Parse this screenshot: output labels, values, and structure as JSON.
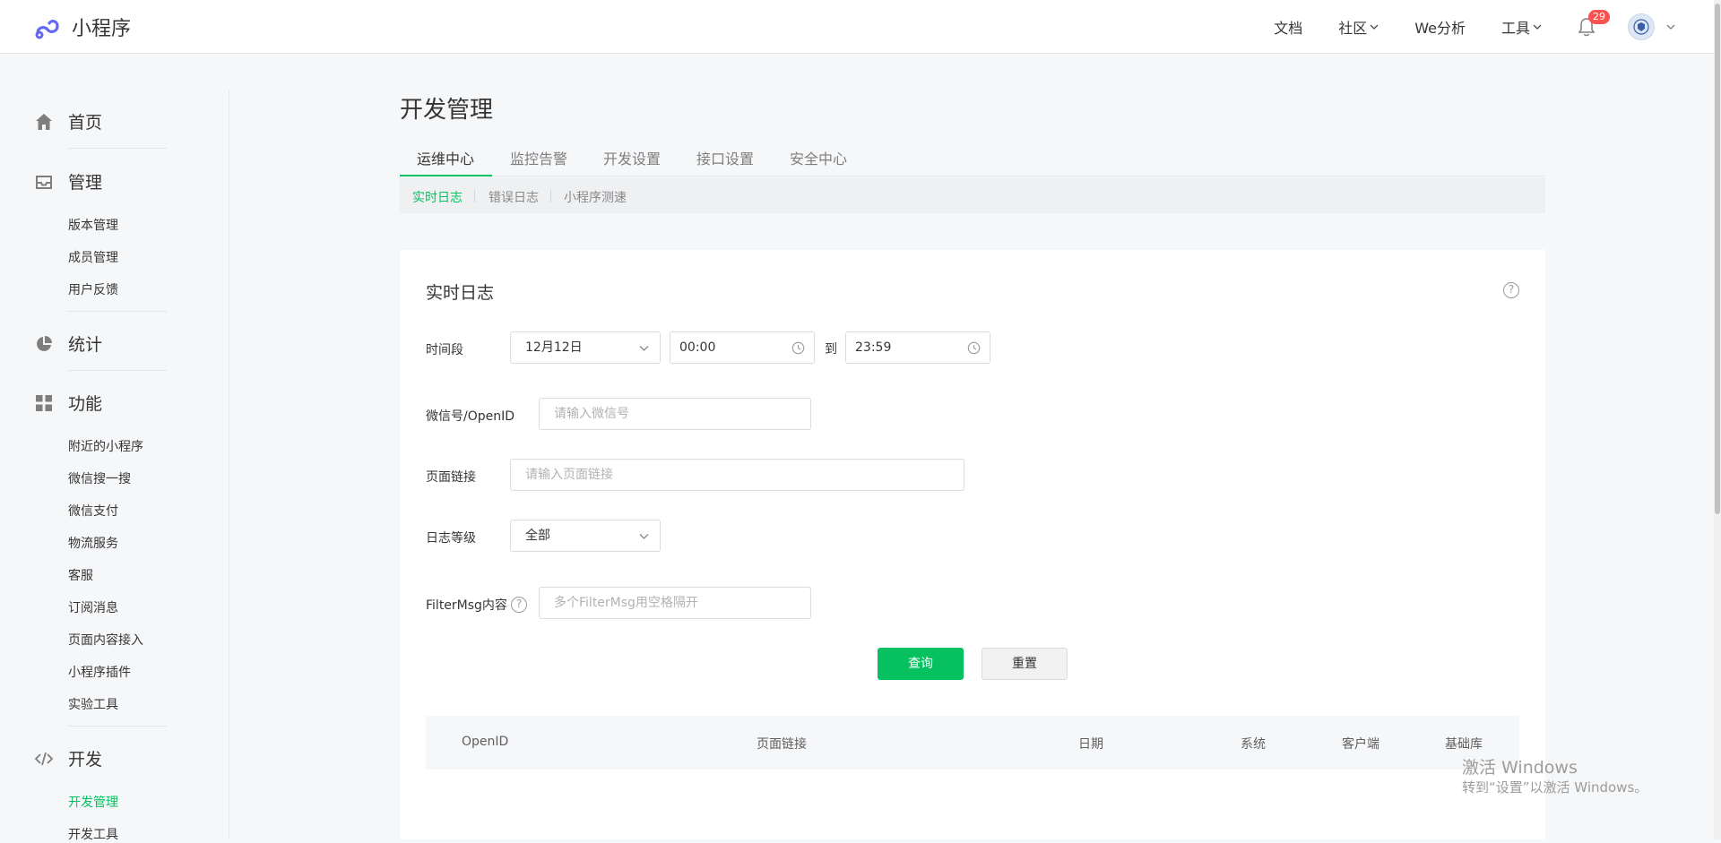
{
  "header": {
    "logo_text": "小程序",
    "nav": [
      {
        "label": "文档"
      },
      {
        "label": "社区"
      },
      {
        "label": "We分析"
      },
      {
        "label": "工具"
      }
    ],
    "notification_count": "29"
  },
  "sidebar": {
    "home": {
      "label": "首页"
    },
    "manage": {
      "label": "管理",
      "items": [
        "版本管理",
        "成员管理",
        "用户反馈"
      ]
    },
    "stats": {
      "label": "统计"
    },
    "features": {
      "label": "功能",
      "items": [
        "附近的小程序",
        "微信搜一搜",
        "微信支付",
        "物流服务",
        "客服",
        "订阅消息",
        "页面内容接入",
        "小程序插件",
        "实验工具"
      ]
    },
    "dev": {
      "label": "开发",
      "items": [
        "开发管理",
        "开发工具"
      ]
    }
  },
  "main": {
    "title": "开发管理",
    "tabs": [
      "运维中心",
      "监控告警",
      "开发设置",
      "接口设置",
      "安全中心"
    ],
    "subtabs": [
      "实时日志",
      "错误日志",
      "小程序测速"
    ],
    "card": {
      "title": "实时日志",
      "time_label": "时间段",
      "date_value": "12月12日",
      "start_time": "00:00",
      "to_text": "到",
      "end_time": "23:59",
      "openid_label": "微信号/OpenID",
      "openid_placeholder": "请输入微信号",
      "page_label": "页面链接",
      "page_placeholder": "请输入页面链接",
      "level_label": "日志等级",
      "level_value": "全部",
      "filter_label": "FilterMsg内容",
      "filter_placeholder": "多个FilterMsg用空格隔开",
      "query_button": "查询",
      "reset_button": "重置",
      "table_headers": [
        "OpenID",
        "页面链接",
        "日期",
        "系统",
        "客户端",
        "基础库"
      ]
    }
  },
  "watermark": {
    "line1": "激活 Windows",
    "line2": "转到“设置”以激活 Windows。"
  },
  "colors": {
    "accent": "#07c160",
    "badge": "#fa5151"
  }
}
